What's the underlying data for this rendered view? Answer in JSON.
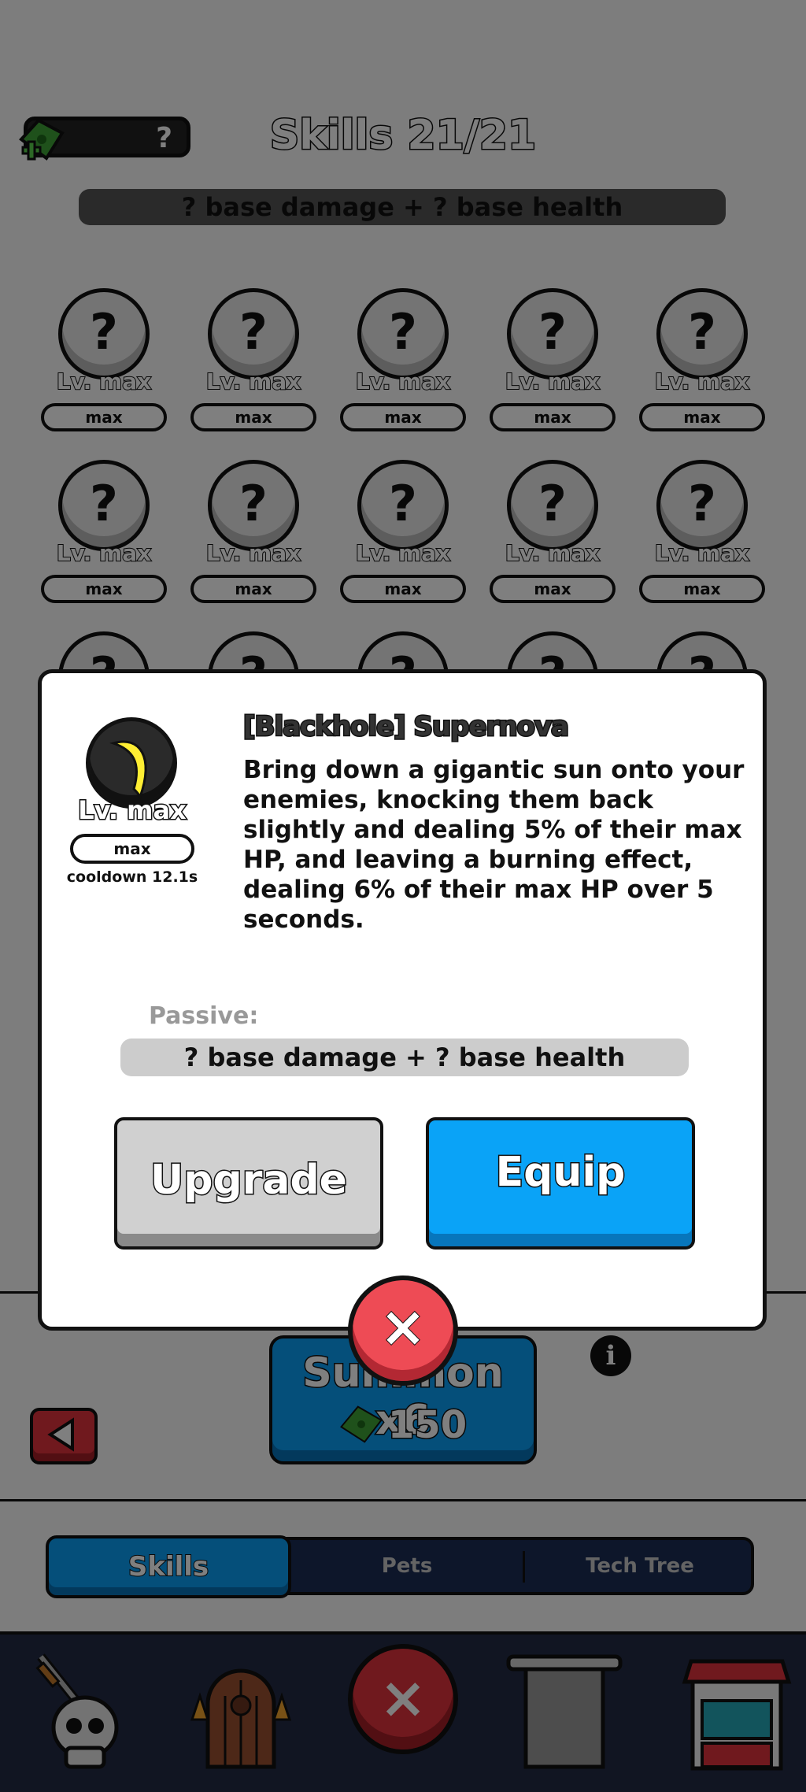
{
  "header": {
    "currency_value": "?",
    "title": "Skills 21/21",
    "summary": "? base damage + ? base health"
  },
  "skill_grid": {
    "rows": [
      [
        {
          "icon": "?",
          "level": "Lv. max",
          "badge": "max"
        },
        {
          "icon": "?",
          "level": "Lv. max",
          "badge": "max"
        },
        {
          "icon": "?",
          "level": "Lv. max",
          "badge": "max"
        },
        {
          "icon": "?",
          "level": "Lv. max",
          "badge": "max"
        },
        {
          "icon": "?",
          "level": "Lv. max",
          "badge": "max"
        }
      ],
      [
        {
          "icon": "?",
          "level": "Lv. max",
          "badge": "max"
        },
        {
          "icon": "?",
          "level": "Lv. max",
          "badge": "max"
        },
        {
          "icon": "?",
          "level": "Lv. max",
          "badge": "max"
        },
        {
          "icon": "?",
          "level": "Lv. max",
          "badge": "max"
        },
        {
          "icon": "?",
          "level": "Lv. max",
          "badge": "max"
        }
      ],
      [
        {
          "icon": "?"
        },
        {
          "icon": "?"
        },
        {
          "icon": "?"
        },
        {
          "icon": "?"
        },
        {
          "icon": "?"
        }
      ]
    ]
  },
  "summon": {
    "label": "Summon x6",
    "cost": "150"
  },
  "tabs": [
    {
      "label": "Skills",
      "active": true
    },
    {
      "label": "Pets",
      "active": false
    },
    {
      "label": "Tech Tree",
      "active": false
    }
  ],
  "navbar": {
    "icons": [
      "skull-sword-icon",
      "dungeon-door-icon",
      "close-icon",
      "scroll-banner-icon",
      "shop-icon"
    ]
  },
  "modal": {
    "skill_level": "Lv. max",
    "skill_badge": "max",
    "cooldown": "cooldown 12.1s",
    "name": "[Blackhole] Supernova",
    "description": "Bring down a gigantic sun onto your enemies, knocking them back slightly and dealing 5% of their max HP, and leaving a burning effect, dealing 6% of their max HP over 5 seconds.",
    "passive_label": "Passive:",
    "passive_value": "? base damage + ? base health",
    "upgrade_label": "Upgrade",
    "equip_label": "Equip",
    "close_icon": "close-icon"
  },
  "colors": {
    "accent_blue": "#0aa3f7",
    "close_red": "#ee4b55",
    "navbar_bg": "#232a45",
    "ticket_green": "#3fa336"
  }
}
